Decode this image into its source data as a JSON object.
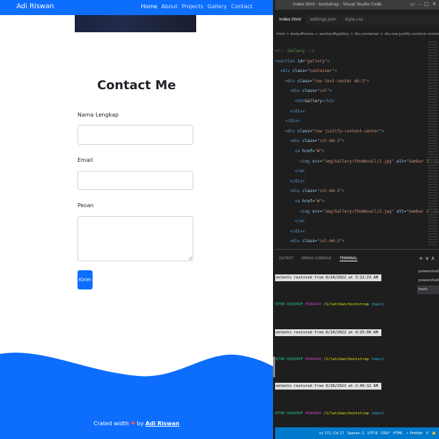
{
  "browser": {
    "brand": "Adi Riswan",
    "nav": [
      "Home",
      "About",
      "Projects",
      "Gallery",
      "Contact"
    ],
    "contact_title": "Contact Me",
    "labels": {
      "name": "Nama Lengkap",
      "email": "Email",
      "message": "Pesan"
    },
    "send_label": "Kirim",
    "footer_prefix": "Crated width",
    "footer_by": "by",
    "footer_author": "Adi Riswan",
    "colors": {
      "primary": "#0d6efd"
    }
  },
  "vscode": {
    "window_title": "index.html - bootstrap - Visual Studio Code",
    "tabs": [
      "index.html",
      "settings.json",
      "style.css"
    ],
    "breadcrumb": "html  >  body#home  >  section#gallery  >  div.container  >  div.row.justify-content-center",
    "code_lines": [
      [
        [
          "c-com",
          "<!-- Gallery -->"
        ]
      ],
      [
        [
          "c-tag",
          "<section "
        ],
        [
          "c-attr",
          "id="
        ],
        [
          "c-str",
          "\"gallery\""
        ],
        [
          "c-tag",
          ">"
        ]
      ],
      [
        [
          "c-txt",
          "  "
        ],
        [
          "c-tag",
          "<div "
        ],
        [
          "c-attr",
          "class="
        ],
        [
          "c-str",
          "\"container\""
        ],
        [
          "c-tag",
          ">"
        ]
      ],
      [
        [
          "c-txt",
          "    "
        ],
        [
          "c-tag",
          "<div "
        ],
        [
          "c-attr",
          "class="
        ],
        [
          "c-str",
          "\"row text-center mb-3\""
        ],
        [
          "c-tag",
          ">"
        ]
      ],
      [
        [
          "c-txt",
          "      "
        ],
        [
          "c-tag",
          "<div "
        ],
        [
          "c-attr",
          "class="
        ],
        [
          "c-str",
          "\"col\""
        ],
        [
          "c-tag",
          ">"
        ]
      ],
      [
        [
          "c-txt",
          "        "
        ],
        [
          "c-tag",
          "<h2>"
        ],
        [
          "c-txt",
          "Gallery"
        ],
        [
          "c-tag",
          "</h2>"
        ]
      ],
      [
        [
          "c-txt",
          "      "
        ],
        [
          "c-tag",
          "</div>"
        ]
      ],
      [
        [
          "c-txt",
          "    "
        ],
        [
          "c-tag",
          "</div>"
        ]
      ],
      [
        [
          "c-txt",
          "    "
        ],
        [
          "c-tag",
          "<div "
        ],
        [
          "c-attr",
          "class="
        ],
        [
          "c-str",
          "\"row justify-content-center\""
        ],
        [
          "c-tag",
          ">"
        ]
      ],
      [
        [
          "c-txt",
          "      "
        ],
        [
          "c-tag",
          "<div "
        ],
        [
          "c-attr",
          "class="
        ],
        [
          "c-str",
          "\"col-md-3\""
        ],
        [
          "c-tag",
          ">"
        ]
      ],
      [
        [
          "c-txt",
          "        "
        ],
        [
          "c-tag",
          "<a "
        ],
        [
          "c-attr",
          "href="
        ],
        [
          "c-str",
          "\"#\""
        ],
        [
          "c-tag",
          ">"
        ]
      ],
      [
        [
          "c-txt",
          "          "
        ],
        [
          "c-tag",
          "<img "
        ],
        [
          "c-attr",
          "src="
        ],
        [
          "c-str",
          "\"img/Gallery/thumbnail/1.jpg\""
        ],
        [
          "c-attr",
          " alt="
        ],
        [
          "c-str",
          "\"Gambar 1\""
        ],
        [
          "c-attr",
          " class="
        ],
        [
          "c-str",
          "\"i"
        ]
      ],
      [
        [
          "c-txt",
          "        "
        ],
        [
          "c-tag",
          "</a>"
        ]
      ],
      [
        [
          "c-txt",
          "      "
        ],
        [
          "c-tag",
          "</div>"
        ]
      ],
      [
        [
          "c-txt",
          "      "
        ],
        [
          "c-tag",
          "<div "
        ],
        [
          "c-attr",
          "class="
        ],
        [
          "c-str",
          "\"col-md-3\""
        ],
        [
          "c-tag",
          ">"
        ]
      ],
      [
        [
          "c-txt",
          "        "
        ],
        [
          "c-tag",
          "<a "
        ],
        [
          "c-attr",
          "href="
        ],
        [
          "c-str",
          "\"#\""
        ],
        [
          "c-tag",
          ">"
        ]
      ],
      [
        [
          "c-txt",
          "          "
        ],
        [
          "c-tag",
          "<img "
        ],
        [
          "c-attr",
          "src="
        ],
        [
          "c-str",
          "\"img/Gallery/thumbnail/2.jpg\""
        ],
        [
          "c-attr",
          " alt="
        ],
        [
          "c-str",
          "\"Gambar 2\""
        ],
        [
          "c-attr",
          " class="
        ],
        [
          "c-str",
          "\"i"
        ]
      ],
      [
        [
          "c-txt",
          "        "
        ],
        [
          "c-tag",
          "</a>"
        ]
      ],
      [
        [
          "c-txt",
          "      "
        ],
        [
          "c-tag",
          "</div>"
        ]
      ],
      [
        [
          "c-txt",
          "      "
        ],
        [
          "c-tag",
          "<div "
        ],
        [
          "c-attr",
          "class="
        ],
        [
          "c-str",
          "\"col-md-3\""
        ],
        [
          "c-tag",
          ">"
        ]
      ]
    ],
    "panel_tabs": [
      "OUTPUT",
      "DEBUG CONSOLE",
      "TERMINAL"
    ],
    "panel_controls": "+ ∨ ∧",
    "terminal": {
      "restored": [
        "ontents restored from 6/24/2022 at 3:12:23 AM",
        "ontents restored from 6/24/2022 at 4:25:00 AM",
        "ontents restored from 6/28/2022 at 2:46:12 AM"
      ],
      "host": "KTOP-Q1HV4SF",
      "system": "MINGW64",
      "path": "/1/latihan/bootstrap",
      "branch": "(main)"
    },
    "shells": [
      "powershell",
      "powershell",
      "bash"
    ],
    "status": [
      "Ln 171, Col 17",
      "Spaces: 2",
      "UTF-8",
      "CRLF",
      "HTML",
      "✓ Prettier",
      "⚲",
      "🔔"
    ]
  }
}
